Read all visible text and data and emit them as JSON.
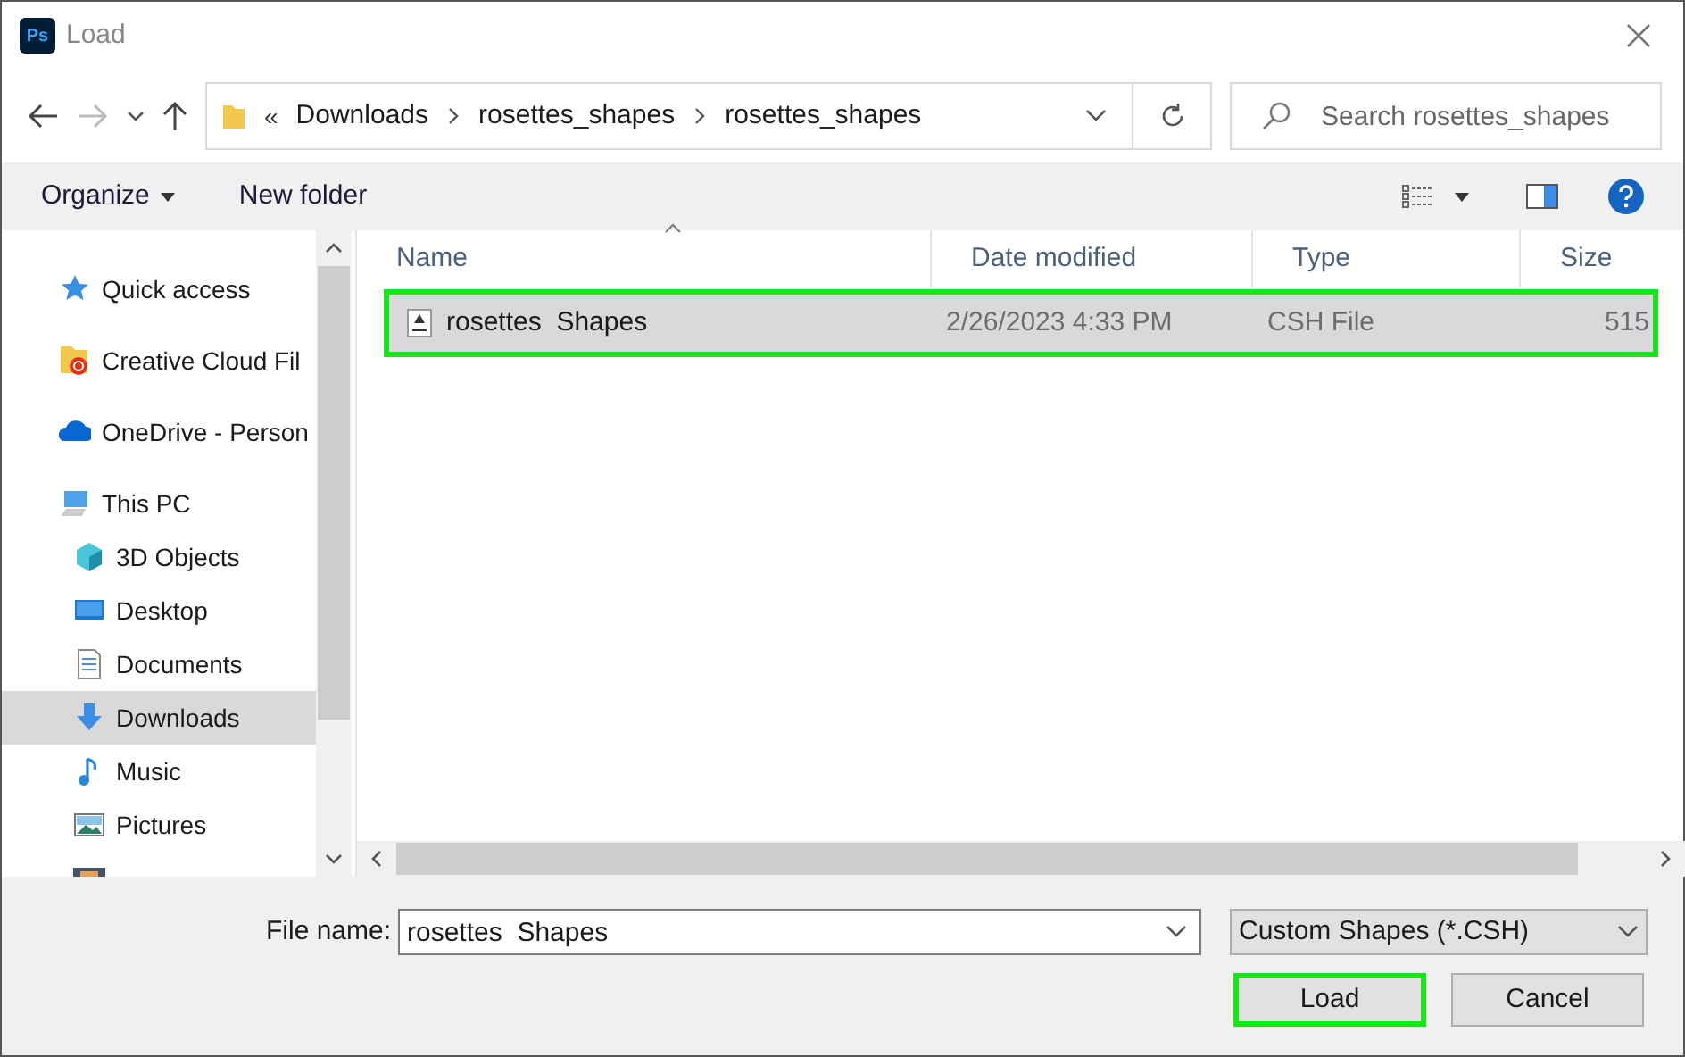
{
  "window": {
    "title": "Load",
    "app_badge": "Ps"
  },
  "address_bar": {
    "overflow": "«",
    "path": [
      "Downloads",
      "rosettes_shapes",
      "rosettes_shapes"
    ]
  },
  "search": {
    "placeholder": "Search rosettes_shapes"
  },
  "toolbar": {
    "organize": "Organize",
    "new_folder": "New folder"
  },
  "sidebar": {
    "items": [
      {
        "label": "Quick access",
        "kind": "star",
        "selected": false
      },
      {
        "label": "Creative Cloud Fil",
        "kind": "cloudfolder",
        "selected": false
      },
      {
        "label": "OneDrive - Person",
        "kind": "onedrive",
        "selected": false
      },
      {
        "label": "This PC",
        "kind": "pc",
        "selected": false,
        "children": [
          {
            "label": "3D Objects",
            "kind": "cube",
            "selected": false
          },
          {
            "label": "Desktop",
            "kind": "desktop",
            "selected": false
          },
          {
            "label": "Documents",
            "kind": "document",
            "selected": false
          },
          {
            "label": "Downloads",
            "kind": "download",
            "selected": true
          },
          {
            "label": "Music",
            "kind": "music",
            "selected": false
          },
          {
            "label": "Pictures",
            "kind": "pictures",
            "selected": false
          }
        ]
      }
    ]
  },
  "table": {
    "columns": [
      "Name",
      "Date modified",
      "Type",
      "Size"
    ],
    "rows": [
      {
        "name": "rosettes  Shapes",
        "date": "2/26/2023 4:33 PM",
        "type": "CSH File",
        "size": "515",
        "selected": true,
        "highlighted": true
      }
    ]
  },
  "footer": {
    "file_name_label": "File name:",
    "file_name": "rosettes  Shapes",
    "file_type": "Custom Shapes (*.CSH)",
    "buttons": [
      {
        "label": "Load",
        "highlighted": true
      },
      {
        "label": "Cancel",
        "highlighted": false
      }
    ]
  }
}
